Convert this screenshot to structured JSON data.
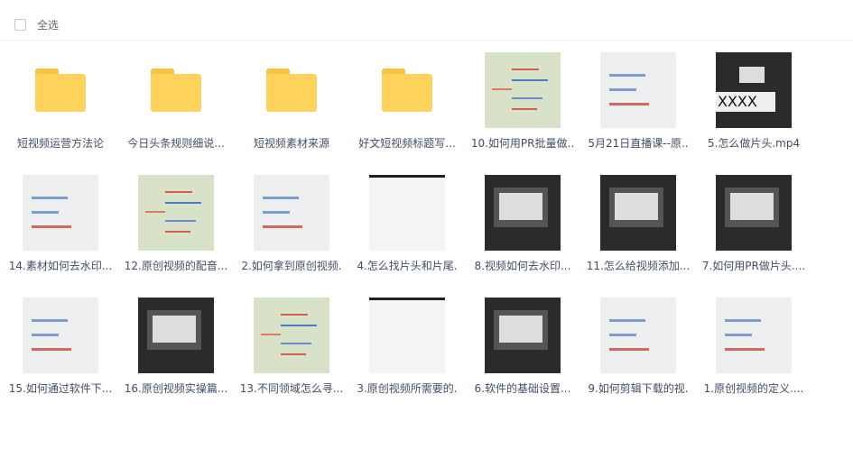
{
  "toolbar": {
    "select_all": "全选"
  },
  "items": [
    {
      "name": "短视频运营方法论",
      "kind": "folder"
    },
    {
      "name": "今日头条规则细说...",
      "kind": "folder"
    },
    {
      "name": "短视频素材来源",
      "kind": "folder"
    },
    {
      "name": "好文短视频标题写...",
      "kind": "folder"
    },
    {
      "name": "10.如何用PR批量做..",
      "kind": "mind"
    },
    {
      "name": "5月21日直播课--原..",
      "kind": "light"
    },
    {
      "name": "5.怎么做片头.mp4",
      "kind": "dark",
      "overlay": "XXXX"
    },
    {
      "name": "14.素材如何去水印...",
      "kind": "light"
    },
    {
      "name": "12.原创视频的配音...",
      "kind": "mind"
    },
    {
      "name": "2.如何拿到原创视频.",
      "kind": "light"
    },
    {
      "name": "4.怎么找片头和片尾.",
      "kind": "white"
    },
    {
      "name": "8.视频如何去水印...",
      "kind": "dark"
    },
    {
      "name": "11.怎么给视频添加...",
      "kind": "dark"
    },
    {
      "name": "7.如何用PR做片头....",
      "kind": "dark"
    },
    {
      "name": "15.如何通过软件下...",
      "kind": "light"
    },
    {
      "name": "16.原创视频实操篇...",
      "kind": "dark"
    },
    {
      "name": "13.不同领域怎么寻...",
      "kind": "mind"
    },
    {
      "name": "3.原创视频所需要的.",
      "kind": "white"
    },
    {
      "name": "6.软件的基础设置...",
      "kind": "dark"
    },
    {
      "name": "9.如何剪辑下载的视.",
      "kind": "light"
    },
    {
      "name": "1.原创视频的定义....",
      "kind": "light"
    }
  ]
}
